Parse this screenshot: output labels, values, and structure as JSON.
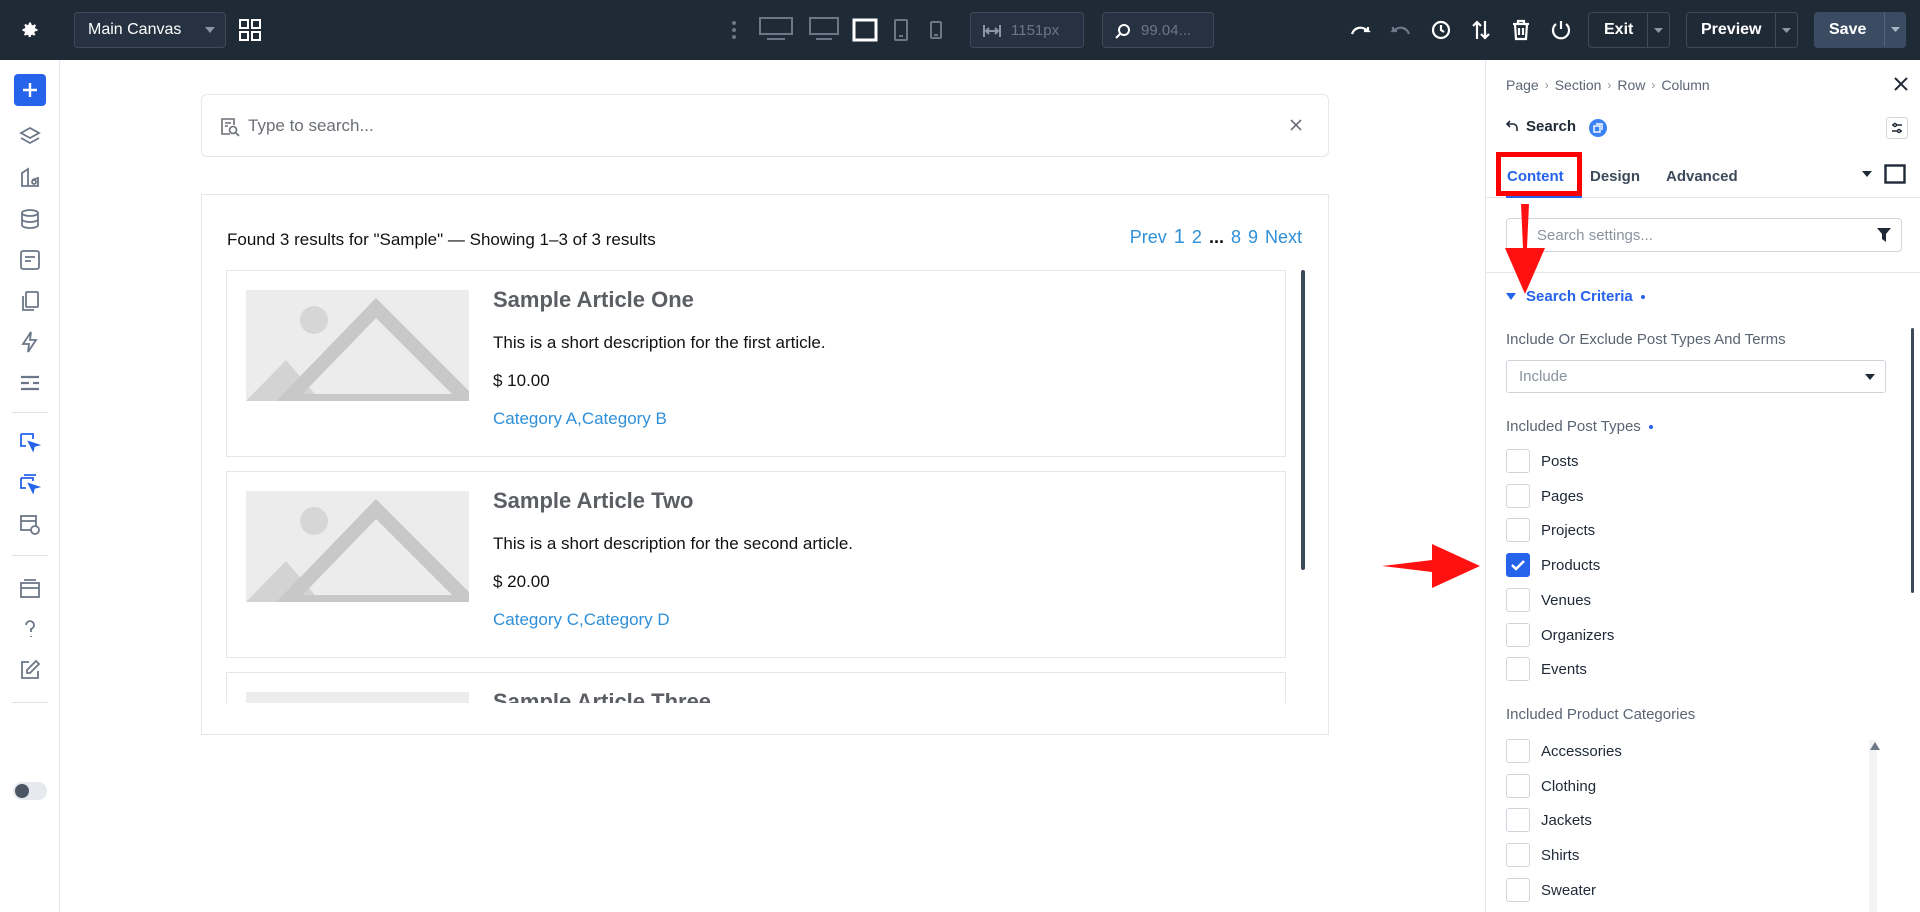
{
  "topbar": {
    "canvas_select": "Main Canvas",
    "width_value": "1151px",
    "zoom_value": "99.04...",
    "exit_label": "Exit",
    "preview_label": "Preview",
    "save_label": "Save"
  },
  "canvas": {
    "search_placeholder": "Type to search...",
    "results_summary": "Found 3 results for \"Sample\" — Showing 1–3 of 3 results",
    "pagination": {
      "prev": "Prev",
      "pages": [
        "1",
        "2"
      ],
      "ellipsis": "...",
      "end_pages": [
        "8",
        "9"
      ],
      "next": "Next"
    },
    "results": [
      {
        "title": "Sample Article One",
        "description": "This is a short description for the first article.",
        "price": "$ 10.00",
        "categories": "Category A,Category B"
      },
      {
        "title": "Sample Article Two",
        "description": "This is a short description for the second article.",
        "price": "$ 20.00",
        "categories": "Category C,Category D"
      },
      {
        "title": "Sample Article Three",
        "description": "",
        "price": "",
        "categories": ""
      }
    ]
  },
  "panel": {
    "breadcrumb": [
      "Page",
      "Section",
      "Row",
      "Column"
    ],
    "module_name": "Search",
    "tabs": [
      "Content",
      "Design",
      "Advanced"
    ],
    "settings_search_placeholder": "Search settings...",
    "section_title": "Search Criteria",
    "include_label": "Include Or Exclude Post Types And Terms",
    "include_value": "Include",
    "post_types_label": "Included Post Types",
    "post_types": [
      {
        "label": "Posts",
        "checked": false
      },
      {
        "label": "Pages",
        "checked": false
      },
      {
        "label": "Projects",
        "checked": false
      },
      {
        "label": "Products",
        "checked": true
      },
      {
        "label": "Venues",
        "checked": false
      },
      {
        "label": "Organizers",
        "checked": false
      },
      {
        "label": "Events",
        "checked": false
      }
    ],
    "categories_label": "Included Product Categories",
    "categories": [
      {
        "label": "Accessories",
        "checked": false
      },
      {
        "label": "Clothing",
        "checked": false
      },
      {
        "label": "Jackets",
        "checked": false
      },
      {
        "label": "Shirts",
        "checked": false
      },
      {
        "label": "Sweater",
        "checked": false
      }
    ]
  },
  "colors": {
    "topbar_bg": "#1f2a37",
    "accent": "#2563eb",
    "link": "#2f8fd8",
    "annotation_red": "#ff0000"
  }
}
